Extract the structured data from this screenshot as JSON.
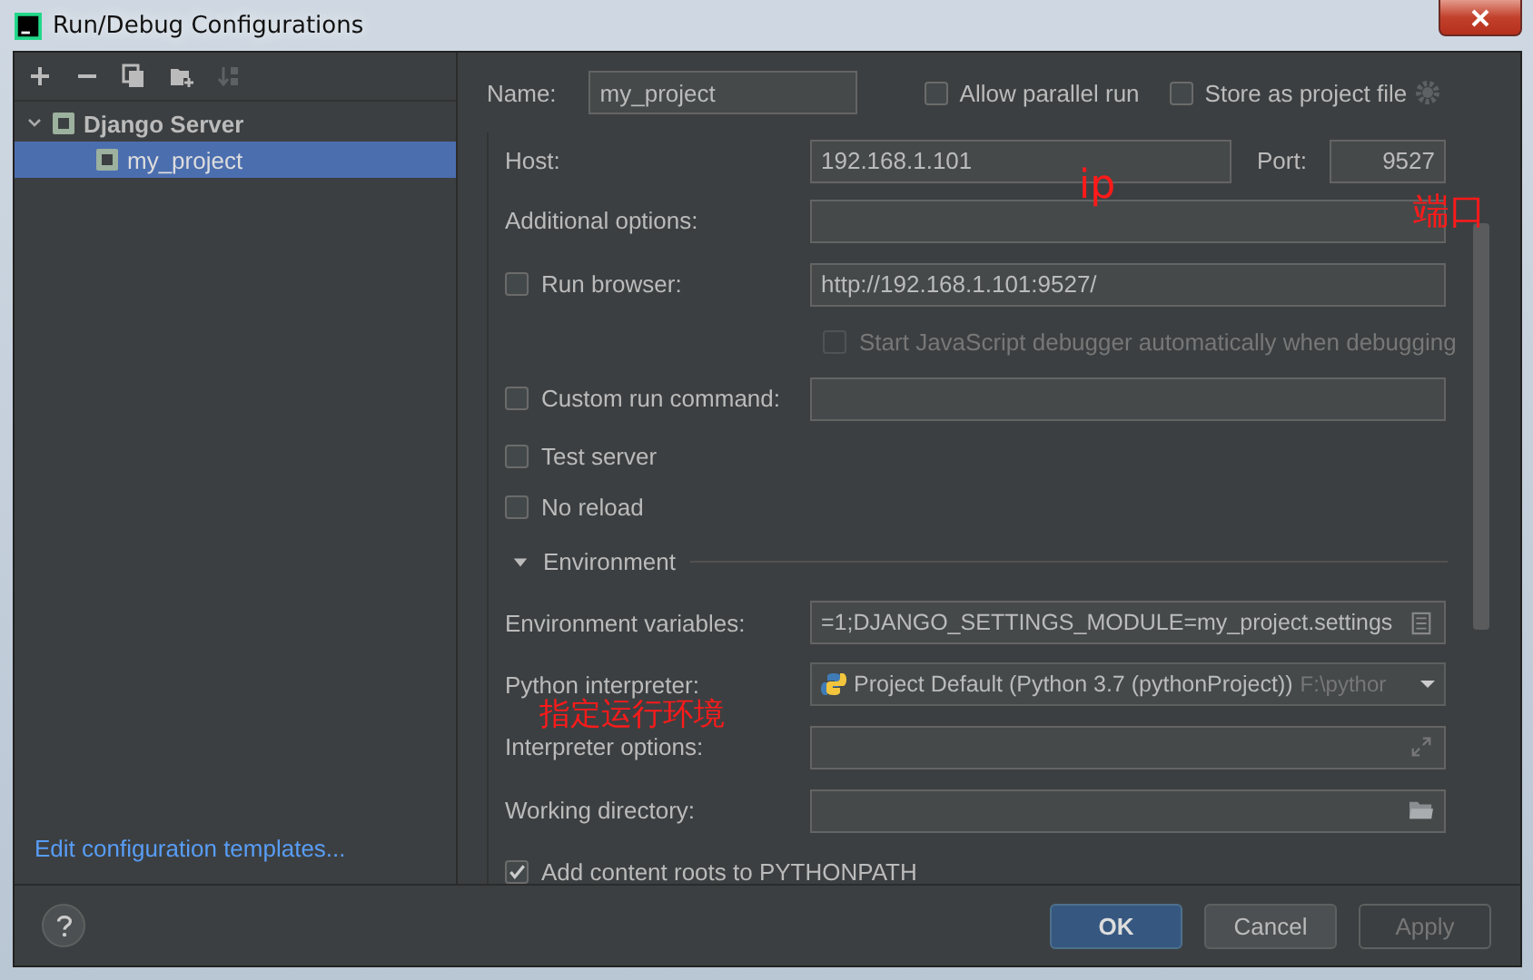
{
  "window": {
    "title": "Run/Debug Configurations"
  },
  "tree": [
    {
      "label": "Django Server",
      "expanded": true,
      "selected": false,
      "children": [
        {
          "label": "my_project",
          "selected": true
        }
      ]
    }
  ],
  "templates_link": "Edit configuration templates...",
  "name_field": {
    "label": "Name:",
    "value": "my_project"
  },
  "header_options": [
    {
      "label": "Allow parallel run",
      "checked": false
    },
    {
      "label": "Store as project file",
      "checked": false
    }
  ],
  "form_rows": [
    {
      "kind": "host",
      "label": "Host:",
      "value": "192.168.1.101",
      "port_label": "Port:",
      "port_value": "9527"
    },
    {
      "kind": "field",
      "label": "Additional options:"
    },
    {
      "kind": "checkbox_field",
      "label": "Run browser:",
      "checked": false,
      "value": "http://192.168.1.101:9527/"
    },
    {
      "kind": "checkbox",
      "label": "Start JavaScript debugger automatically when debugging",
      "checked": false,
      "disabled": true
    },
    {
      "kind": "checkbox_field",
      "label": "Custom run command:",
      "checked": false
    },
    {
      "kind": "checkbox",
      "label": "Test server",
      "checked": false,
      "disabled": false
    },
    {
      "kind": "checkbox",
      "label": "No reload",
      "checked": false,
      "disabled": false
    },
    {
      "kind": "section",
      "label": "Environment",
      "expanded": true
    },
    {
      "kind": "env_field",
      "label": "Environment variables:",
      "value": "=1;DJANGO_SETTINGS_MODULE=my_project.settings"
    },
    {
      "kind": "dropdown",
      "label": "Python interpreter:",
      "value": "Project Default (Python 3.7 (pythonProject))",
      "hint": "F:\\pythor"
    },
    {
      "kind": "options_field",
      "label": "Interpreter options:"
    },
    {
      "kind": "dir_field",
      "label": "Working directory:"
    },
    {
      "kind": "wide_checkbox",
      "label": "Add content roots to PYTHONPATH",
      "checked": true
    }
  ],
  "annotations": [
    {
      "text": "ip"
    },
    {
      "text": "端口"
    },
    {
      "text": "指定运行环境"
    }
  ],
  "buttons": [
    {
      "label": "OK",
      "kind": "default"
    },
    {
      "label": "Cancel",
      "kind": "normal"
    },
    {
      "label": "Apply",
      "kind": "disabled"
    }
  ]
}
